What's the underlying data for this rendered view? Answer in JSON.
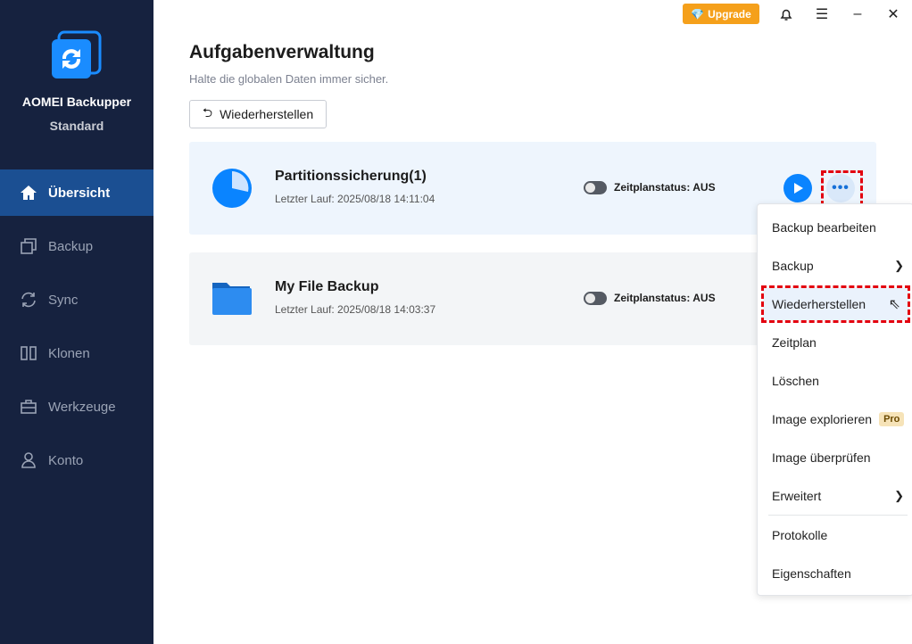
{
  "app": {
    "name": "AOMEI Backupper",
    "edition": "Standard"
  },
  "topbar": {
    "upgrade": "Upgrade"
  },
  "sidebar": {
    "items": [
      {
        "label": "Übersicht"
      },
      {
        "label": "Backup"
      },
      {
        "label": "Sync"
      },
      {
        "label": "Klonen"
      },
      {
        "label": "Werkzeuge"
      },
      {
        "label": "Konto"
      }
    ]
  },
  "page": {
    "title": "Aufgabenverwaltung",
    "subtitle": "Halte die globalen Daten immer sicher.",
    "restore_button": "Wiederherstellen"
  },
  "tasks": [
    {
      "name": "Partitionssicherung(1)",
      "last_run": "Letzter Lauf: 2025/08/18 14:11:04",
      "schedule": "Zeitplanstatus: AUS"
    },
    {
      "name": "My File Backup",
      "last_run": "Letzter Lauf: 2025/08/18 14:03:37",
      "schedule": "Zeitplanstatus: AUS"
    }
  ],
  "menu": {
    "items": [
      "Backup bearbeiten",
      "Backup",
      "Wiederherstellen",
      "Zeitplan",
      "Löschen",
      "Image explorieren",
      "Image überprüfen",
      "Erweitert",
      "Protokolle",
      "Eigenschaften"
    ],
    "pro_badge": "Pro"
  },
  "colors": {
    "accent": "#0a84ff",
    "sidebar": "#16223f",
    "highlight": "#e3000f"
  }
}
